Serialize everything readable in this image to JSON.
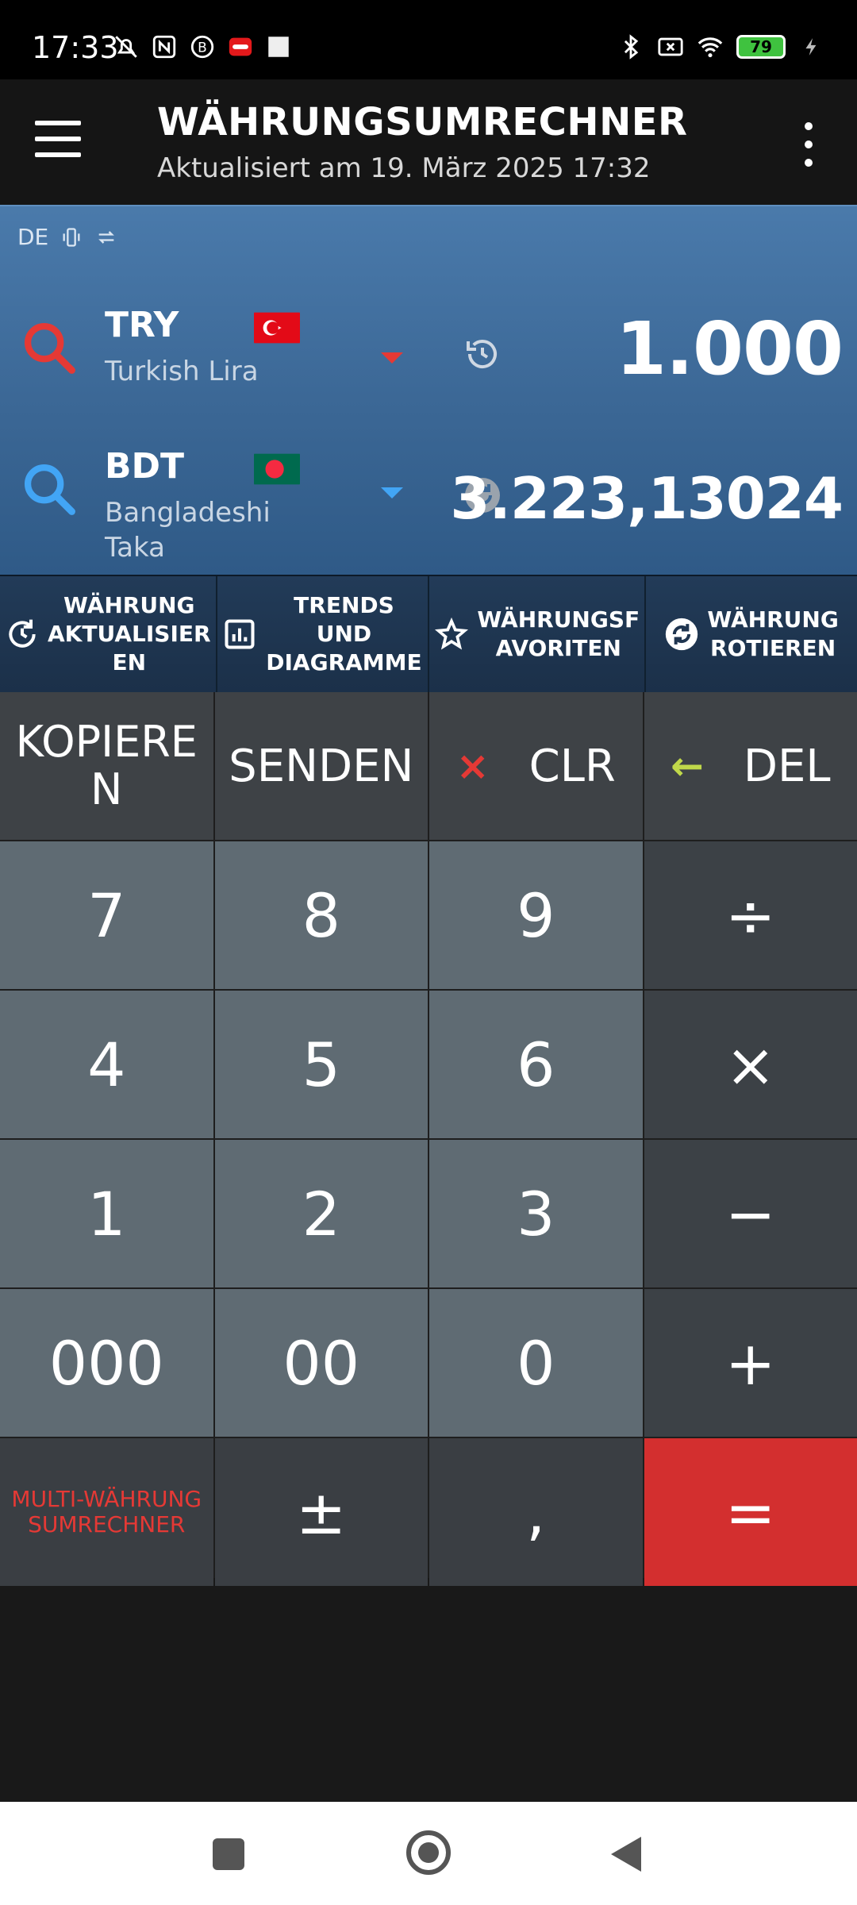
{
  "status_bar": {
    "time": "17:33",
    "battery": "79",
    "left_icons": [
      "bell-off-icon",
      "nfc-icon",
      "b-badge-icon",
      "otto-app-icon",
      "square-icon"
    ],
    "right_icons": [
      "bluetooth-icon",
      "no-sim-icon",
      "wifi-icon",
      "battery-icon",
      "charging-icon"
    ]
  },
  "app_bar": {
    "title": "WÄHRUNGSUMRECHNER",
    "subtitle": "Aktualisiert am 19. März 2025 17:32"
  },
  "converter": {
    "locale": "DE",
    "from": {
      "code": "TRY",
      "name": "Turkish Lira",
      "amount": "1.000",
      "accent": "#e53935",
      "flag_colors": [
        "#e30a17",
        "#ffffff"
      ]
    },
    "to": {
      "code": "BDT",
      "name": "Bangladeshi Taka",
      "amount": "3.223,13024",
      "accent": "#42a5f5",
      "flag_colors": [
        "#006a4e",
        "#f42a41"
      ]
    }
  },
  "actions": [
    {
      "label": "WÄHRUNG\nAKTUALISIER\nEN",
      "icon": "refresh-clock-icon"
    },
    {
      "label": "TRENDS UND\nDIAGRAMME",
      "icon": "chart-icon"
    },
    {
      "label": "WÄHRUNGSF\nAVORITEN",
      "icon": "star-icon"
    },
    {
      "label": "WÄHRUNG\nROTIEREN",
      "icon": "rotate-icon"
    }
  ],
  "keypad": {
    "copy": "KOPIERE\nN",
    "send": "SENDEN",
    "clr": "CLR",
    "del": "DEL",
    "clr_icon": "×",
    "del_icon": "←",
    "digits": {
      "k7": "7",
      "k8": "8",
      "k9": "9",
      "k4": "4",
      "k5": "5",
      "k6": "6",
      "k1": "1",
      "k2": "2",
      "k3": "3",
      "k000": "000",
      "k00": "00",
      "k0": "0"
    },
    "divide": "÷",
    "multiply": "×",
    "minus": "−",
    "plus": "+",
    "multi": "MULTI-WÄHRUNG\nSUMRECHNER",
    "plusminus": "±",
    "comma": ",",
    "equals": "="
  },
  "colors": {
    "panel": "#3b6795",
    "digit_key": "#5f6b73",
    "op_key": "#3c4146",
    "equals_key": "#d32f2f",
    "clr_icon": "#e53935",
    "del_icon": "#c0d84a"
  }
}
